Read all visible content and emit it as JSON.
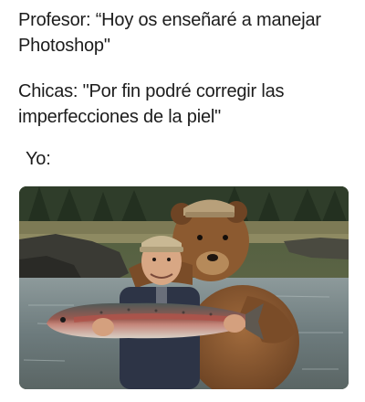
{
  "meme": {
    "profesor_line": "Profesor: “Hoy os enseñaré a manejar Photoshop\"",
    "chicas_line": "Chicas: \"Por fin podré corregir las imperfecciones de la piel\"",
    "yo_line": "Yo:"
  },
  "photo": {
    "subject_icon": "bear-hugging-fisherman-illustration",
    "colors": {
      "forest": "#2f3d2a",
      "river": "#7c8a8e",
      "bear_fur": "#8a5a32",
      "fish": "#7a6a5e",
      "fish_stripe": "#b0524a"
    }
  }
}
